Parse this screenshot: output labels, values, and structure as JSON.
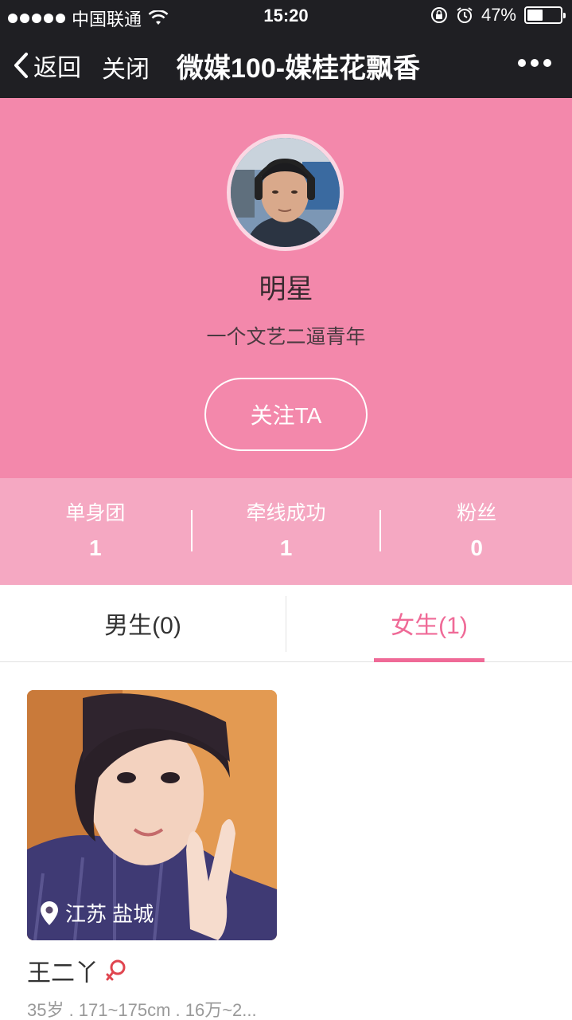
{
  "status_bar": {
    "carrier": "中国联通",
    "time": "15:20",
    "battery_percent": "47%",
    "battery_level": 0.47
  },
  "nav": {
    "back_label": "返回",
    "close_label": "关闭",
    "title": "微媒100-媒桂花飘香"
  },
  "profile": {
    "name": "明星",
    "bio": "一个文艺二逼青年",
    "follow_label": "关注TA"
  },
  "stats": [
    {
      "label": "单身团",
      "value": "1"
    },
    {
      "label": "牵线成功",
      "value": "1"
    },
    {
      "label": "粉丝",
      "value": "0"
    }
  ],
  "tabs": {
    "male": "男生(0)",
    "female": "女生(1)",
    "active": "female"
  },
  "cards": [
    {
      "location": "江苏 盐城",
      "name": "王二丫",
      "gender_icon": "female-symbol-icon",
      "info": "35岁 . 171~175cm . 16万~2..."
    }
  ],
  "colors": {
    "header_bg": "#1f1f23",
    "profile_bg": "#f388ab",
    "stats_bg": "#f5a8c2",
    "accent": "#ef6a97"
  }
}
